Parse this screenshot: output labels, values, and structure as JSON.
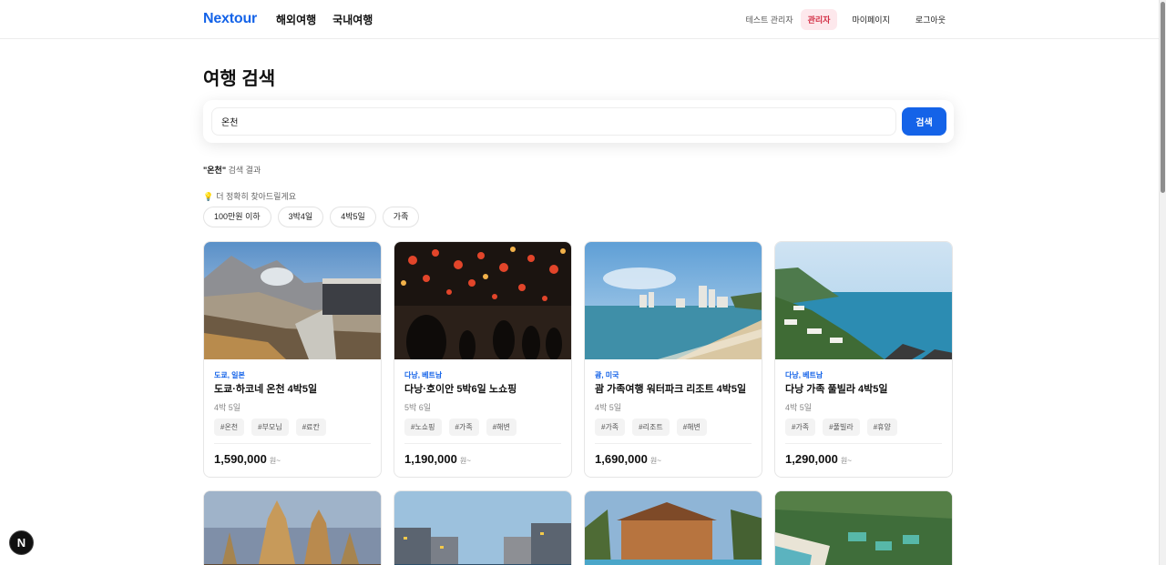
{
  "header": {
    "logo": "Nextour",
    "nav": [
      "해외여행",
      "국내여행"
    ],
    "admin_name": "테스트 관리자",
    "admin_badge": "관리자",
    "mypage": "마이페이지",
    "logout": "로그아웃"
  },
  "page": {
    "title": "여행 검색"
  },
  "search": {
    "value": "온천",
    "button": "검색"
  },
  "results": {
    "query": "\"온천\"",
    "suffix": " 검색 결과"
  },
  "hint": {
    "icon": "lightbulb-icon",
    "text": "더 정확히 찾아드릴게요"
  },
  "chips": [
    "100만원 이하",
    "3박4일",
    "4박5일",
    "가족"
  ],
  "cards": [
    {
      "location": "도쿄, 일본",
      "title": "도쿄·하코네 온천 4박5일",
      "duration": "4박 5일",
      "tags": [
        "#온천",
        "#부모님",
        "#료칸"
      ],
      "price": "1,590,000",
      "unit": "원~"
    },
    {
      "location": "다낭, 베트남",
      "title": "다낭·호이안 5박6일 노쇼핑",
      "duration": "5박 6일",
      "tags": [
        "#노쇼핑",
        "#가족",
        "#해변"
      ],
      "price": "1,190,000",
      "unit": "원~"
    },
    {
      "location": "괌, 미국",
      "title": "괌 가족여행 워터파크 리조트 4박5일",
      "duration": "4박 5일",
      "tags": [
        "#가족",
        "#리조트",
        "#해변"
      ],
      "price": "1,690,000",
      "unit": "원~"
    },
    {
      "location": "다낭, 베트남",
      "title": "다낭 가족 풀빌라 4박5일",
      "duration": "4박 5일",
      "tags": [
        "#가족",
        "#풀빌라",
        "#휴양"
      ],
      "price": "1,290,000",
      "unit": "원~"
    }
  ],
  "colors": {
    "brand": "#1463e8",
    "admin_badge_bg": "#fde8ec",
    "admin_badge_text": "#d32f45"
  },
  "next_badge": "N"
}
